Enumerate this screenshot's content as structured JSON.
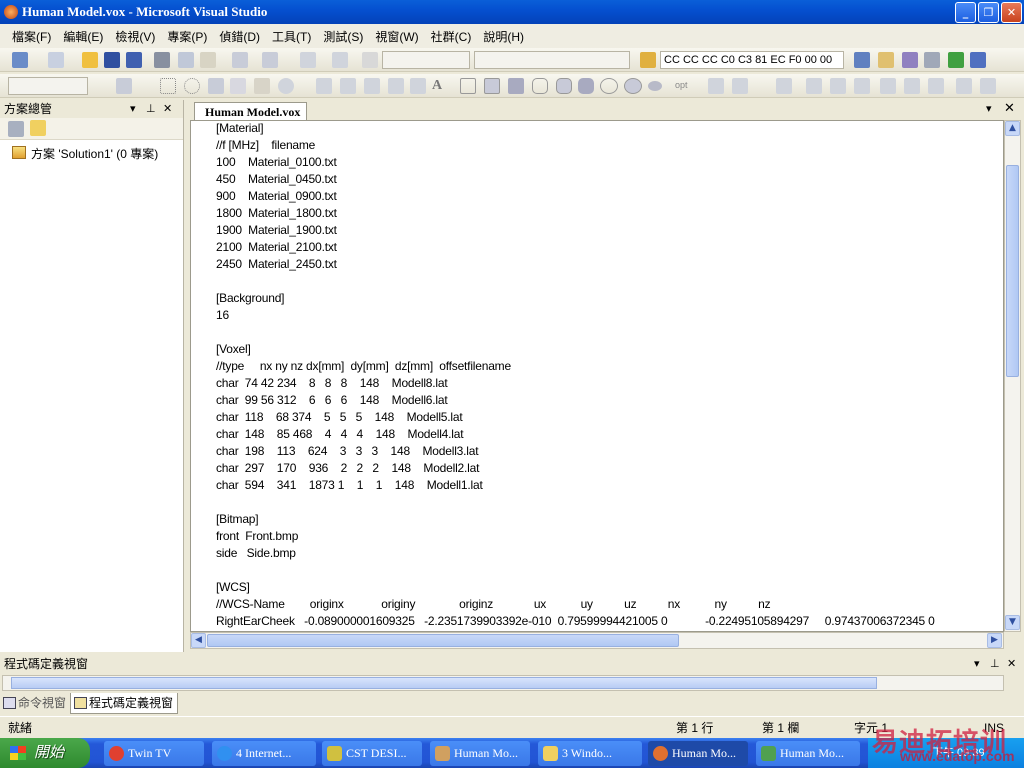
{
  "window": {
    "title": "Human Model.vox - Microsoft Visual Studio",
    "minimize": "_",
    "maximize": "❐",
    "close": "✕"
  },
  "menu": [
    "檔案(F)",
    "編輯(E)",
    "檢視(V)",
    "專案(P)",
    "偵錯(D)",
    "工具(T)",
    "測試(S)",
    "視窗(W)",
    "社群(C)",
    "說明(H)"
  ],
  "toolbar": {
    "find_combo_value": "CC CC CC C0 C3 81 EC F0 00 00",
    "opt_label": "opt"
  },
  "solution_explorer": {
    "title": "方案總管",
    "item": "方案 'Solution1' (0 專案)"
  },
  "document": {
    "tab": "Human Model.vox",
    "lines": [
      "[Material]",
      "//f [MHz]    filename",
      "100    Material_0100.txt",
      "450    Material_0450.txt",
      "900    Material_0900.txt",
      "1800  Material_1800.txt",
      "1900  Material_1900.txt",
      "2100  Material_2100.txt",
      "2450  Material_2450.txt",
      "",
      "[Background]",
      "16",
      "",
      "[Voxel]",
      "//type     nx ny nz dx[mm]  dy[mm]  dz[mm]  offsetfilename",
      "char  74 42 234    8   8   8    148    Modell8.lat",
      "char  99 56 312    6   6   6    148    Modell6.lat",
      "char  118    68 374    5   5   5    148    Modell5.lat",
      "char  148    85 468    4   4   4    148    Modell4.lat",
      "char  198    113    624    3   3   3    148    Modell3.lat",
      "char  297    170    936    2   2   2    148    Modell2.lat",
      "char  594    341    1873 1    1    1    148    Modell1.lat",
      "",
      "[Bitmap]",
      "front  Front.bmp",
      "side   Side.bmp",
      "",
      "[WCS]",
      "//WCS-Name        originx            originy              originz             ux           uy          uz          nx           ny          nz",
      "RightEarCheek   -0.089000001609325   -2.2351739903392e-010  0.79599994421005 0            -0.22495105894297     0.97437006372345 0"
    ]
  },
  "code_definition_panel": {
    "title": "程式碼定義視窗"
  },
  "bottom_tabs": [
    "命令視窗",
    "程式碼定義視窗"
  ],
  "status": {
    "ready": "就緒",
    "line": "第 1 行",
    "column": "第 1 欄",
    "char": "字元 1",
    "mode": "INS"
  },
  "taskbar": {
    "start": "開始",
    "tasks": [
      "Twin TV",
      "4 Internet...",
      "CST DESI...",
      "Human Mo...",
      "3 Windo...",
      "Human Mo...",
      "Human Mo..."
    ],
    "active_task": 5,
    "clock": "下午 09:39"
  },
  "watermark": {
    "text": "易迪拓培训",
    "site": "www.edatop.com"
  },
  "colors": {
    "titlebar": "#0550d0",
    "taskbar": "#2458d8",
    "start": "#3c983c"
  }
}
